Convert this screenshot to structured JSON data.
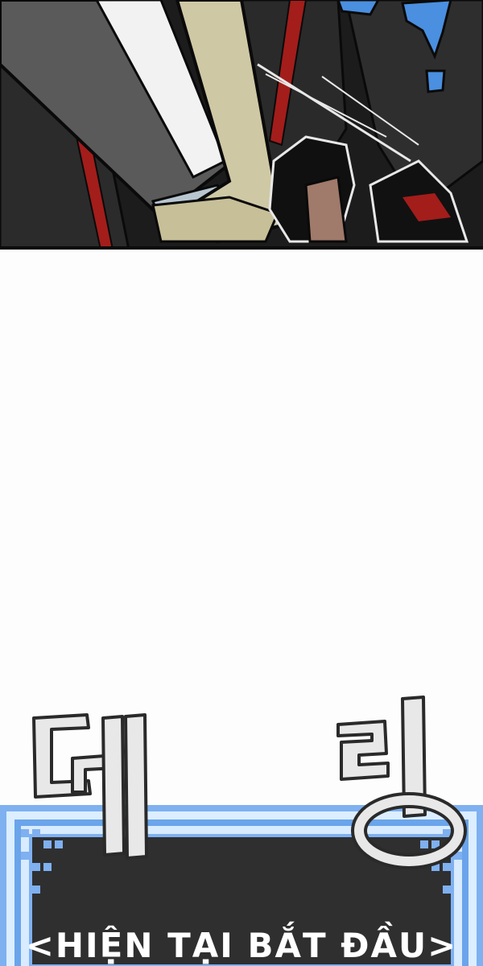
{
  "comic": {
    "sfx_top": "-",
    "sfx_ding_left": "",
    "sfx_ding_right": ""
  },
  "banner": {
    "text": "<HIỆN TẠI BẮT ĐẦU>"
  },
  "colors": {
    "banner_frame": "#7fb0f0",
    "banner_inner": "#2f2f30",
    "sfx_blue": "#4a8fe0",
    "accent_red": "#b0201c",
    "sfx_fill": "#e8e8e8"
  }
}
